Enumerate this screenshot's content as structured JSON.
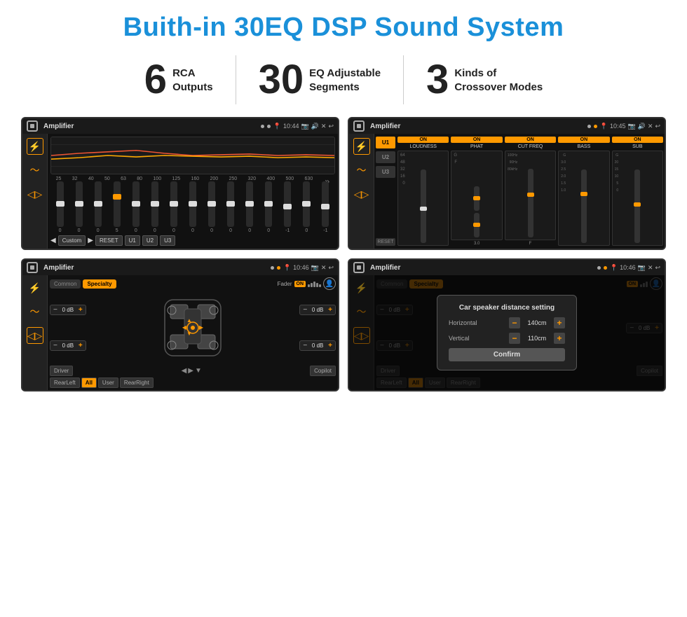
{
  "page": {
    "title": "Buith-in 30EQ DSP Sound System",
    "stats": [
      {
        "number": "6",
        "line1": "RCA",
        "line2": "Outputs"
      },
      {
        "number": "30",
        "line1": "EQ Adjustable",
        "line2": "Segments"
      },
      {
        "number": "3",
        "line1": "Kinds of",
        "line2": "Crossover Modes"
      }
    ]
  },
  "screens": {
    "eq": {
      "title": "Amplifier",
      "time": "10:44",
      "graph_label": "EQ Graph",
      "freq_labels": [
        "25",
        "32",
        "40",
        "50",
        "63",
        "80",
        "100",
        "125",
        "160",
        "200",
        "250",
        "320",
        "400",
        "500",
        "630"
      ],
      "slider_values": [
        "0",
        "0",
        "0",
        "5",
        "0",
        "0",
        "0",
        "0",
        "0",
        "0",
        "0",
        "0",
        "-1",
        "0",
        "-1"
      ],
      "buttons": [
        "Custom",
        "RESET",
        "U1",
        "U2",
        "U3"
      ]
    },
    "crossover": {
      "title": "Amplifier",
      "time": "10:45",
      "presets": [
        "U1",
        "U2",
        "U3"
      ],
      "channels": [
        {
          "on": true,
          "label": "LOUDNESS"
        },
        {
          "on": true,
          "label": "PHAT"
        },
        {
          "on": true,
          "label": "CUT FREQ"
        },
        {
          "on": true,
          "label": "BASS"
        },
        {
          "on": true,
          "label": "SUB"
        }
      ],
      "reset_label": "RESET"
    },
    "speaker1": {
      "title": "Amplifier",
      "time": "10:46",
      "tabs": [
        "Common",
        "Specialty"
      ],
      "active_tab": "Specialty",
      "fader_label": "Fader",
      "on_label": "ON",
      "db_controls": [
        "0 dB",
        "0 dB",
        "0 dB",
        "0 dB"
      ],
      "bottom_btns": [
        "Driver",
        "Copilot",
        "RearLeft",
        "All",
        "User",
        "RearRight"
      ]
    },
    "speaker2": {
      "title": "Amplifier",
      "time": "10:46",
      "tabs": [
        "Common",
        "Specialty"
      ],
      "active_tab": "Specialty",
      "on_label": "ON",
      "dialog": {
        "title": "Car speaker distance setting",
        "horizontal_label": "Horizontal",
        "horizontal_value": "140cm",
        "vertical_label": "Vertical",
        "vertical_value": "110cm",
        "confirm_label": "Confirm"
      },
      "db_controls": [
        "0 dB",
        "0 dB"
      ],
      "bottom_btns": [
        "Driver",
        "Copilot",
        "RearLeft",
        "All",
        "User",
        "RearRight"
      ]
    }
  }
}
